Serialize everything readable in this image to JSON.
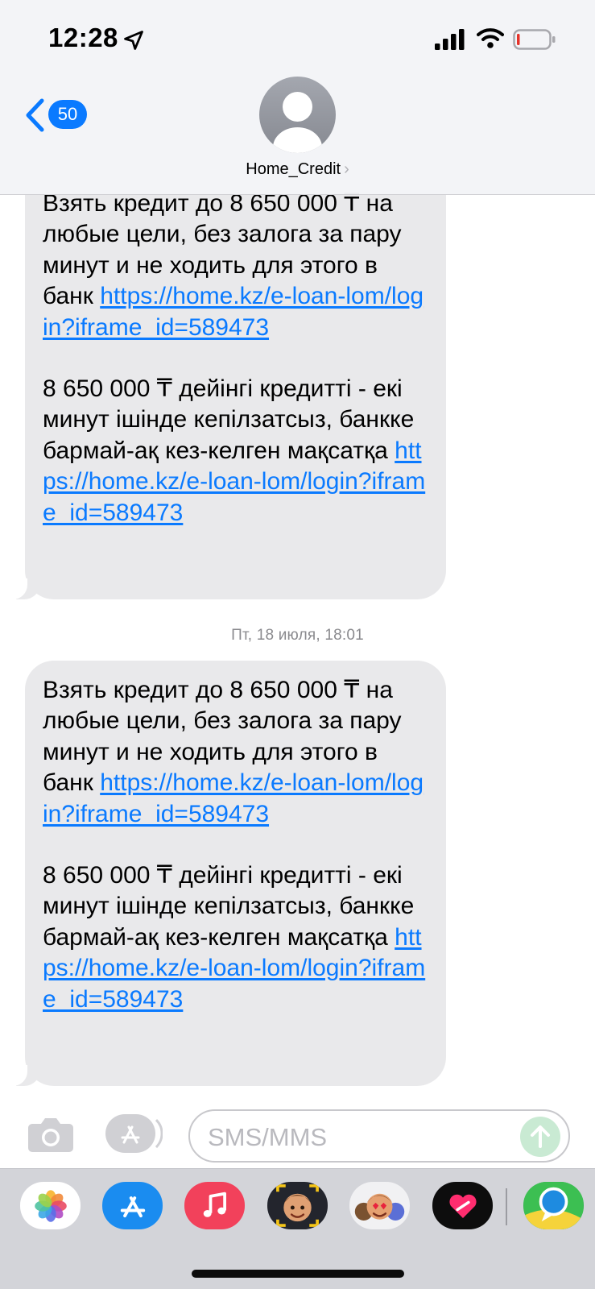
{
  "status_bar": {
    "time": "12:28"
  },
  "header": {
    "back_badge": "50",
    "contact_name": "Home_Credit",
    "contact_chevron": "›"
  },
  "messages": [
    {
      "ru_text": "Взять кредит до 8 650 000 ₸ на любые цели, без залога за пару минут и не ходить для этого в банк ",
      "ru_link": "https://home.kz/e-loan-lom/login?iframe_id=589473",
      "kz_text": "8 650 000 ₸ дейінгі кредитті - екі минут ішінде кепілзатсыз, банкке бармай-ақ кез-келген мақсатқа ",
      "kz_link": "https://home.kz/e-loan-lom/login?iframe_id=589473"
    },
    {
      "ru_text": "Взять кредит до 8 650 000 ₸ на любые цели, без залога за пару минут и не ходить для этого в банк ",
      "ru_link": "https://home.kz/e-loan-lom/login?iframe_id=589473",
      "kz_text": "8 650 000 ₸ дейінгі кредитті - екі минут ішінде кепілзатсыз, банкке бармай-ақ кез-келген мақсатқа ",
      "kz_link": "https://home.kz/e-loan-lom/login?iframe_id=589473"
    }
  ],
  "timestamp": "Пт, 18 июля, 18:01",
  "composer": {
    "placeholder": "SMS/MMS"
  },
  "icons": {
    "status": [
      "location-arrow-icon",
      "cellular-signal-icon",
      "wifi-icon",
      "battery-low-icon"
    ],
    "header": [
      "back-chevron-icon",
      "contact-avatar-icon"
    ],
    "composer": [
      "camera-icon",
      "app-store-icon",
      "send-arrow-icon"
    ],
    "drawer": [
      "photos-icon",
      "app-store-icon",
      "music-icon",
      "memoji-icon",
      "memoji-stickers-icon",
      "digital-touch-heart-icon",
      "maps-icon"
    ]
  },
  "colors": {
    "link": "#0a7aff",
    "bubble": "#e9e9eb",
    "badge": "#0a7aff",
    "battery_low": "#e5332a",
    "send_button": "#c9ead3"
  }
}
